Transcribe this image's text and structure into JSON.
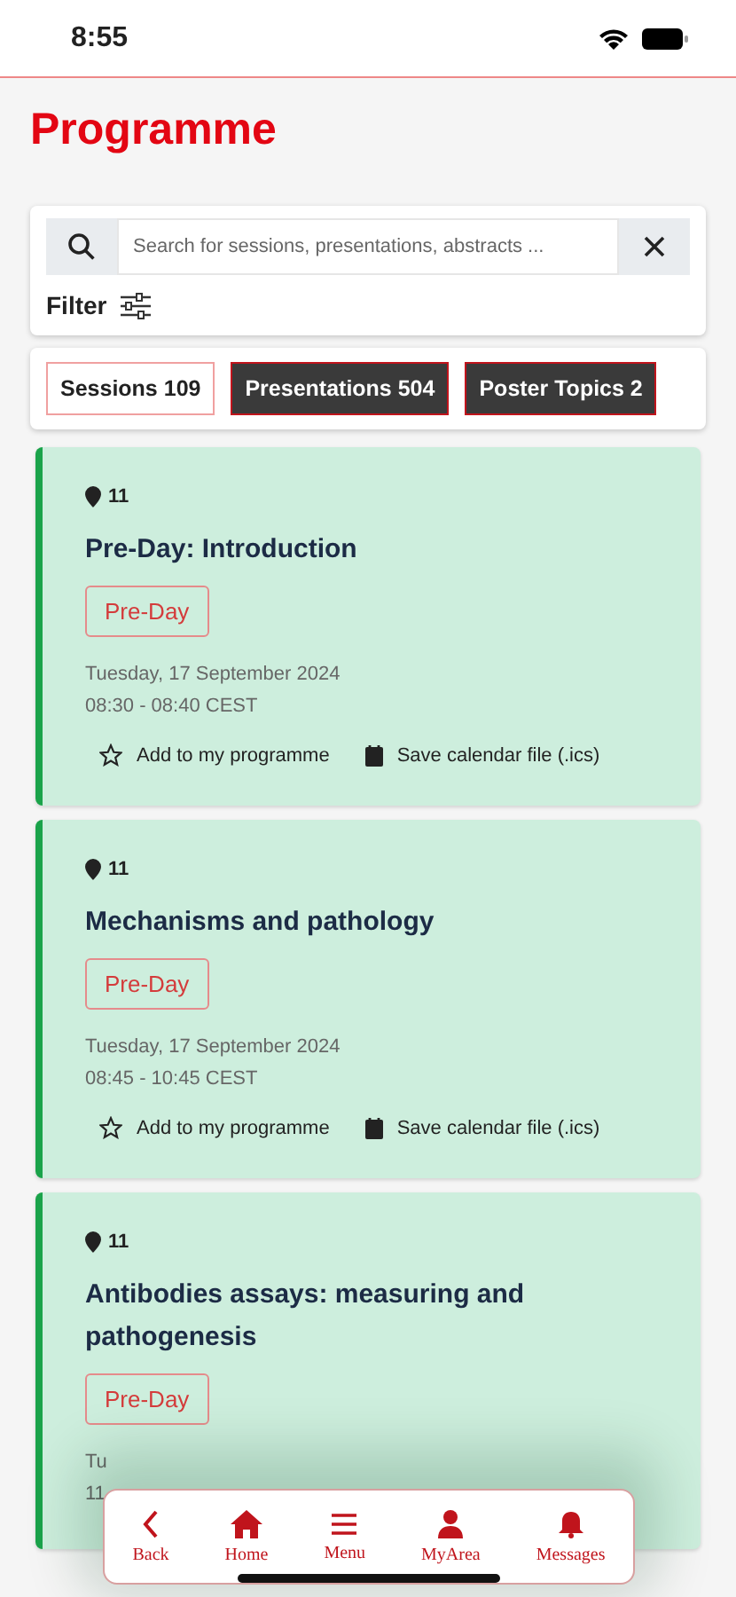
{
  "status_bar": {
    "time": "8:55"
  },
  "title": "Programme",
  "search": {
    "placeholder": "Search for sessions, presentations, abstracts ..."
  },
  "filter": {
    "label": "Filter"
  },
  "tabs": [
    {
      "label": "Sessions 109",
      "selected": true
    },
    {
      "label": "Presentations 504",
      "selected": false
    },
    {
      "label": "Poster Topics 2",
      "selected": false
    }
  ],
  "sessions": [
    {
      "room": "11",
      "title": "Pre-Day: Introduction",
      "tag": "Pre-Day",
      "date": "Tuesday, 17 September 2024",
      "time": "08:30 - 08:40 CEST",
      "actions": [
        "Add to my programme",
        "Save calendar file (.ics)"
      ]
    },
    {
      "room": "11",
      "title": "Mechanisms and pathology",
      "tag": "Pre-Day",
      "date": "Tuesday, 17 September 2024",
      "time": "08:45 - 10:45 CEST",
      "actions": [
        "Add to my programme",
        "Save calendar file (.ics)"
      ]
    },
    {
      "room": "11",
      "title": "Antibodies assays: measuring and pathogenesis",
      "tag": "Pre-Day",
      "date": "Tu",
      "time": "11"
    }
  ],
  "nav": [
    {
      "kind": "back",
      "label": "Back"
    },
    {
      "kind": "home",
      "label": "Home"
    },
    {
      "kind": "menu",
      "label": "Menu"
    },
    {
      "kind": "person",
      "label": "MyArea"
    },
    {
      "kind": "bell",
      "label": "Messages"
    }
  ]
}
